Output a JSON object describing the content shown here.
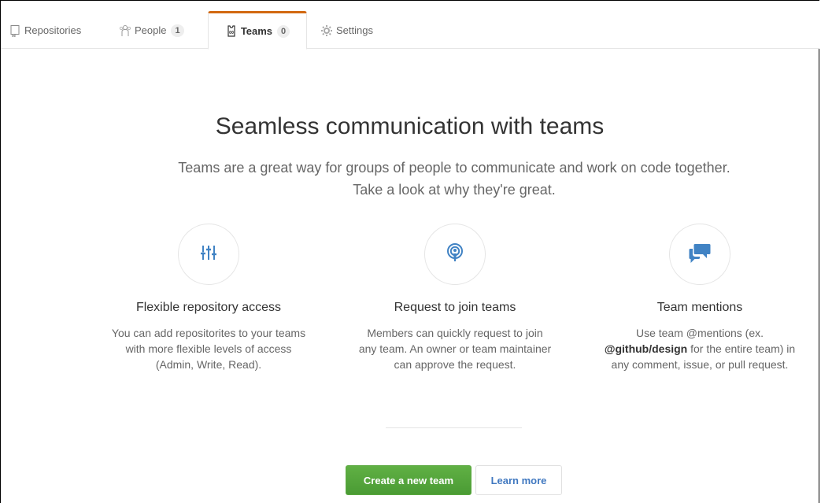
{
  "tabs": {
    "repositories": {
      "label": "Repositories"
    },
    "people": {
      "label": "People",
      "count": "1"
    },
    "teams": {
      "label": "Teams",
      "count": "0"
    },
    "settings": {
      "label": "Settings"
    }
  },
  "hero": {
    "title": "Seamless communication with teams",
    "subtitle_line1": "Teams are a great way for groups of people to communicate and work on code together.",
    "subtitle_line2": "Take a look at why they're great."
  },
  "features": [
    {
      "icon": "settings-sliders-icon",
      "title": "Flexible repository access",
      "line1": "You can add repositorites to your teams",
      "line2": "with more flexible levels of access",
      "line3": "(Admin, Write, Read)."
    },
    {
      "icon": "broadcast-icon",
      "title": "Request to join teams",
      "line1": "Members can quickly request to join",
      "line2": "any team. An owner or team maintainer",
      "line3": "can approve the request."
    },
    {
      "icon": "comment-discussion-icon",
      "title": "Team mentions",
      "line1": "Use team @mentions (ex.",
      "mention": "@github/design",
      "line2_rest": " for the entire team) in",
      "line3": "any comment, issue, or pull request."
    }
  ],
  "actions": {
    "create_label": "Create a new team",
    "learn_label": "Learn more"
  },
  "colors": {
    "accent_tab": "#d26911",
    "primary_button": "#55a532",
    "link_blue": "#4078c0",
    "icon_blue": "#4183c4"
  }
}
